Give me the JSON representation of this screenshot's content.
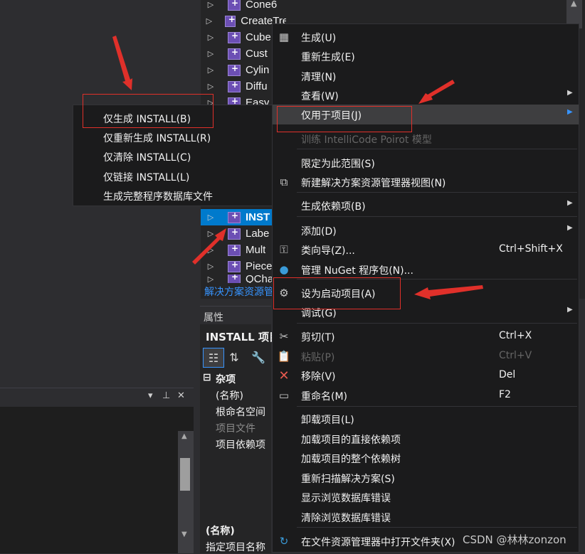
{
  "solution_explorer": {
    "items": [
      {
        "label": "Cone6",
        "selected": false
      },
      {
        "label": "CreateTree",
        "selected": false
      },
      {
        "label": "Cube",
        "selected": false
      },
      {
        "label": "Cust",
        "selected": false
      },
      {
        "label": "Cylin",
        "selected": false
      },
      {
        "label": "Diffu",
        "selected": false
      },
      {
        "label": "Easy",
        "selected": false
      },
      {
        "label": "INST",
        "selected": true
      },
      {
        "label": "Labe",
        "selected": false
      },
      {
        "label": "Mult",
        "selected": false
      },
      {
        "label": "Piece",
        "selected": false
      },
      {
        "label": "QCha",
        "selected": false
      }
    ],
    "footer_link": "解决方案资源管理器"
  },
  "properties": {
    "tab": "属性",
    "object": "INSTALL 项目",
    "category": "杂项",
    "rows": [
      "(名称)",
      "根命名空间",
      "项目文件",
      "项目依赖项"
    ],
    "desc_title": "(名称)",
    "desc_text": "指定项目名称"
  },
  "context_menu": {
    "items": [
      {
        "label": "生成(U)",
        "icon": "build-icon"
      },
      {
        "label": "重新生成(E)"
      },
      {
        "label": "清理(N)"
      },
      {
        "label": "查看(W)"
      },
      {
        "label": "仅用于项目(J)"
      },
      {
        "label": "训练 IntelliCode Poirot 模型"
      },
      {
        "label": "限定为此范围(S)"
      },
      {
        "label": "新建解决方案资源管理器视图(N)",
        "icon": "new-view-icon"
      },
      {
        "label": "生成依赖项(B)"
      },
      {
        "label": "添加(D)"
      },
      {
        "label": "类向导(Z)...",
        "shortcut": "Ctrl+Shift+X",
        "icon": "class-wizard-icon"
      },
      {
        "label": "管理 NuGet 程序包(N)...",
        "icon": "nuget-icon"
      },
      {
        "label": "设为启动项目(A)",
        "icon": "gear-icon"
      },
      {
        "label": "调试(G)"
      },
      {
        "label": "剪切(T)",
        "shortcut": "Ctrl+X",
        "icon": "scissors-icon"
      },
      {
        "label": "粘贴(P)",
        "shortcut": "Ctrl+V",
        "icon": "paste-icon"
      },
      {
        "label": "移除(V)",
        "shortcut": "Del",
        "icon": "remove-icon"
      },
      {
        "label": "重命名(M)",
        "shortcut": "F2",
        "icon": "rename-icon"
      },
      {
        "label": "卸载项目(L)"
      },
      {
        "label": "加载项目的直接依赖项"
      },
      {
        "label": "加载项目的整个依赖树"
      },
      {
        "label": "重新扫描解决方案(S)"
      },
      {
        "label": "显示浏览数据库错误"
      },
      {
        "label": "清除浏览数据库错误"
      },
      {
        "label": "在文件资源管理器中打开文件夹(X)",
        "icon": "open-folder-icon"
      }
    ]
  },
  "submenu": {
    "items": [
      "仅生成 INSTALL(B)",
      "仅重新生成 INSTALL(R)",
      "仅清除 INSTALL(C)",
      "仅链接 INSTALL(L)",
      "生成完整程序数据库文件"
    ]
  },
  "watermark": "CSDN @林林zonzon",
  "colors": {
    "selection": "#007acc",
    "annotation_red": "#e0302a",
    "menu_bg": "#1b1b1c",
    "link": "#3794ff"
  }
}
